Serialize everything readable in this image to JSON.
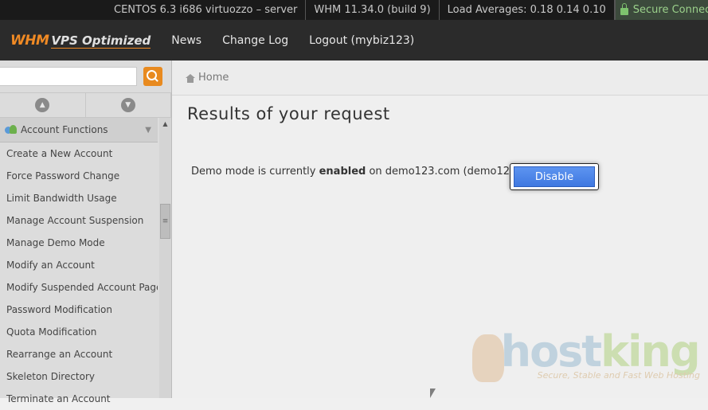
{
  "statusbar": {
    "server": "CENTOS 6.3 i686 virtuozzo – server",
    "whm": "WHM 11.34.0 (build 9)",
    "load": "Load Averages: 0.18 0.14 0.10",
    "secure": "Secure Connection"
  },
  "header": {
    "logo_whm": "WHM",
    "logo_vps": "VPS Optimized",
    "nav": {
      "news": "News",
      "changelog": "Change Log",
      "logout": "Logout (mybiz123)"
    }
  },
  "sidebar": {
    "search_placeholder": "",
    "section_title": "Account Functions",
    "items": [
      "Create a New Account",
      "Force Password Change",
      "Limit Bandwidth Usage",
      "Manage Account Suspension",
      "Manage Demo Mode",
      "Modify an Account",
      "Modify Suspended Account Page",
      "Password Modification",
      "Quota Modification",
      "Rearrange an Account",
      "Skeleton Directory",
      "Terminate an Account"
    ]
  },
  "breadcrumb": {
    "home": "Home"
  },
  "main": {
    "title": "Results of your request",
    "msg_prefix": "Demo mode is currently ",
    "msg_status": "enabled",
    "msg_suffix": " on demo123.com (demo123)",
    "disable_label": "Disable"
  },
  "watermark": {
    "brand_a": "host",
    "brand_b": "king",
    "tagline": "Secure, Stable and Fast Web Hosting"
  },
  "colors": {
    "accent": "#f08a24",
    "button": "#4a82e8",
    "header": "#2b2b2b"
  }
}
